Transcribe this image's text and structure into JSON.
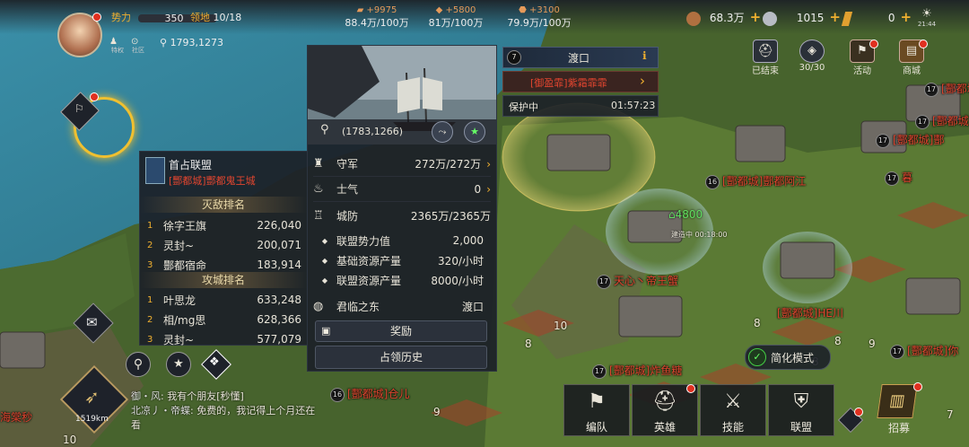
{
  "player": {
    "power_label": "势力",
    "power_value": "350",
    "territory_label": "领地",
    "territory_value": "10/18",
    "coords": "1793,1273",
    "icon_labels": [
      "特权",
      "社区"
    ]
  },
  "resources": [
    {
      "gain": "+9975",
      "value": "88.4万/100万",
      "icon": "wood-icon"
    },
    {
      "gain": "+5800",
      "value": "81万/100万",
      "icon": "iron-icon"
    },
    {
      "gain": "+3100",
      "value": "79.9万/100万",
      "icon": "stone-icon"
    }
  ],
  "currency": [
    {
      "value": "68.3万",
      "icon": "copper-coin-icon"
    },
    {
      "value": "1015",
      "icon": "silver-coin-icon"
    },
    {
      "value": "0",
      "icon": "gold-bar-icon"
    }
  ],
  "clock": "21:44",
  "top_right_buttons": [
    {
      "label": "已结束",
      "icon": "helmet-icon"
    },
    {
      "label": "30/30",
      "icon": "shield-face-icon"
    },
    {
      "label": "活动",
      "icon": "event-icon"
    },
    {
      "label": "商城",
      "icon": "treasure-chest-icon"
    }
  ],
  "tile": {
    "coords": "(1783,1266)",
    "rows": [
      {
        "icon": "guard-icon",
        "label": "守军",
        "value": "272万/272万"
      },
      {
        "icon": "fire-icon",
        "label": "士气",
        "value": "0"
      },
      {
        "icon": "castle-icon",
        "label": "城防",
        "value": "2365万/2365万"
      }
    ],
    "stats": [
      {
        "label": "联盟势力值",
        "value": "2,000"
      },
      {
        "label": "基础资源产量",
        "value": "320/小时"
      },
      {
        "label": "联盟资源产量",
        "value": "8000/小时"
      }
    ],
    "owner": {
      "label": "君临之东",
      "value": "渡口"
    },
    "reward_button": "奖励",
    "history_button": "占领历史"
  },
  "location": {
    "level": "7",
    "name": "渡口",
    "occupier": "[御盈霏]紫霜霏霏",
    "protect_label": "保护中",
    "protect_time": "01:57:23"
  },
  "alliance": {
    "title": "首占联盟",
    "name": "[酆都城]酆都鬼王城",
    "kill_header": "灭敌排名",
    "kill_rank": [
      {
        "rank": "1",
        "name": "徐字王旗",
        "value": "226,040"
      },
      {
        "rank": "2",
        "name": "灵封~",
        "value": "200,071"
      },
      {
        "rank": "3",
        "name": "酆都宿命",
        "value": "183,914"
      }
    ],
    "siege_header": "攻城排名",
    "siege_rank": [
      {
        "rank": "1",
        "name": "叶思龙",
        "value": "633,248"
      },
      {
        "rank": "2",
        "name": "相/mg思",
        "value": "628,366"
      },
      {
        "rank": "3",
        "name": "灵封~",
        "value": "577,079"
      }
    ]
  },
  "map_labels": [
    {
      "level": "16",
      "text": "[酆都城]酆都阿江"
    },
    {
      "level": "17",
      "text": "天心丶帝王蟹"
    },
    {
      "level": "17",
      "text": "[酆都城]炸鱼糖"
    },
    {
      "level": "16",
      "text": "[酆都城]仓儿"
    },
    {
      "level": "",
      "text": "[酆都城]HE川"
    },
    {
      "level": "17",
      "text": "[酆都城]你"
    },
    {
      "level": "17",
      "text": "[酆都城]酆"
    },
    {
      "level": "17",
      "text": "[酆都城]酆"
    },
    {
      "level": "17",
      "text": "[酆都城]酆"
    },
    {
      "level": "17",
      "text": "暮"
    },
    {
      "level": "",
      "text": "海棠秒"
    }
  ],
  "map_troop": {
    "value": "4800",
    "label": "建造中 00:18:00"
  },
  "compass": {
    "distance": "1519km"
  },
  "chat": [
    {
      "channel": "御・风",
      "text": "我有个朋友[秒懂]"
    },
    {
      "channel": "北凉丿・帝蝶",
      "text": "免费的，我记得上个月还在看"
    }
  ],
  "simplify_mode": "简化模式",
  "bottom_buttons": [
    {
      "label": "编队",
      "icon": "flag-icon"
    },
    {
      "label": "英雄",
      "icon": "hero-helmet-icon"
    },
    {
      "label": "技能",
      "icon": "crossed-swords-icon"
    },
    {
      "label": "联盟",
      "icon": "alliance-banner-icon"
    },
    {
      "label": "招募",
      "icon": "recruit-scroll-icon"
    }
  ],
  "colors": {
    "accent_gold": "#f0b030",
    "alert_red": "#e0452f",
    "panel_bg": "#1c2028",
    "map_label_red": "#e0452f"
  }
}
